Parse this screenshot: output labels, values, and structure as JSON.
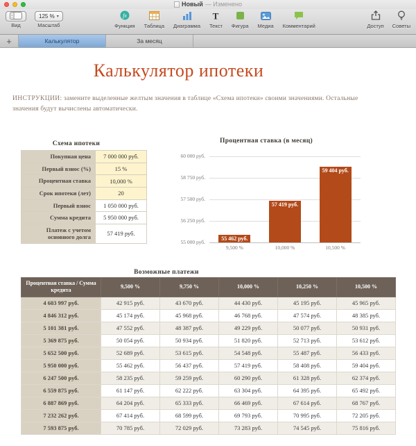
{
  "window": {
    "title": "Новый",
    "status": "— Изменено"
  },
  "toolbar": {
    "view_label": "Вид",
    "zoom_value": "125 %",
    "zoom_label": "Масштаб",
    "items": [
      {
        "label": "Функция",
        "icon": "fx-icon"
      },
      {
        "label": "Таблица",
        "icon": "table-icon"
      },
      {
        "label": "Диаграмма",
        "icon": "chart-icon"
      },
      {
        "label": "Текст",
        "icon": "text-icon"
      },
      {
        "label": "Фигура",
        "icon": "shape-icon"
      },
      {
        "label": "Медиа",
        "icon": "media-icon"
      },
      {
        "label": "Комментарий",
        "icon": "comment-icon"
      }
    ],
    "right": [
      {
        "label": "Доступ",
        "icon": "share-icon"
      },
      {
        "label": "Советы",
        "icon": "tips-icon"
      }
    ]
  },
  "tab_add_label": "+",
  "tabs": [
    {
      "label": "Калькулятор",
      "active": true
    },
    {
      "label": "За месяц",
      "active": false
    }
  ],
  "document": {
    "title": "Калькулятор ипотеки",
    "instructions_prefix": "ИНСТРУКЦИИ:",
    "instructions_body": " замените выделенные желтым значения в таблице «Схема ипотеки» своими значениями. Остальные значения будут вычислены автоматически.",
    "scheme_table": {
      "title": "Схема ипотеки",
      "rows": [
        {
          "label": "Покупная цена",
          "value": "7 000 000 руб.",
          "highlight": true
        },
        {
          "label": "Первый взнос (%)",
          "value": "15 %",
          "highlight": true
        },
        {
          "label": "Процентная ставка",
          "value": "10,000 %",
          "highlight": true
        },
        {
          "label": "Срок ипотеки (лет)",
          "value": "20",
          "highlight": true
        },
        {
          "label": "Первый взнос",
          "value": "1 050 000 руб.",
          "highlight": false
        },
        {
          "label": "Сумма кредита",
          "value": "5 950 000 руб.",
          "highlight": false
        },
        {
          "label": "Платеж с учетом основного долга",
          "value": "57 419 руб.",
          "highlight": false
        }
      ]
    },
    "payments_table": {
      "title": "Возможные платежи",
      "header": [
        "Процентная ставка / Сумма кредита",
        "9,500 %",
        "9,750 %",
        "10,000 %",
        "10,250 %",
        "10,500 %"
      ],
      "rows": [
        {
          "sum": "4 603 997 руб.",
          "cells": [
            "42 915 руб.",
            "43 670 руб.",
            "44 430 руб.",
            "45 195 руб.",
            "45 965 руб."
          ]
        },
        {
          "sum": "4 846 312 руб.",
          "cells": [
            "45 174 руб.",
            "45 968 руб.",
            "46 768 руб.",
            "47 574 руб.",
            "48 385 руб."
          ]
        },
        {
          "sum": "5 101 381 руб.",
          "cells": [
            "47 552 руб.",
            "48 387 руб.",
            "49 229 руб.",
            "50 077 руб.",
            "50 931 руб."
          ]
        },
        {
          "sum": "5 369 875 руб.",
          "cells": [
            "50 054 руб.",
            "50 934 руб.",
            "51 820 руб.",
            "52 713 руб.",
            "53 612 руб."
          ]
        },
        {
          "sum": "5 652 500 руб.",
          "cells": [
            "52 689 руб.",
            "53 615 руб.",
            "54 548 руб.",
            "55 487 руб.",
            "56 433 руб."
          ]
        },
        {
          "sum": "5 950 000 руб.",
          "cells": [
            "55 462 руб.",
            "56 437 руб.",
            "57 419 руб.",
            "58 408 руб.",
            "59 404 руб."
          ]
        },
        {
          "sum": "6 247 500 руб.",
          "cells": [
            "58 235 руб.",
            "59 259 руб.",
            "60 290 руб.",
            "61 328 руб.",
            "62 374 руб."
          ]
        },
        {
          "sum": "6 559 875 руб.",
          "cells": [
            "61 147 руб.",
            "62 222 руб.",
            "63 304 руб.",
            "64 395 руб.",
            "65 492 руб."
          ]
        },
        {
          "sum": "6 887 869 руб.",
          "cells": [
            "64 204 руб.",
            "65 333 руб.",
            "66 469 руб.",
            "67 614 руб.",
            "68 767 руб."
          ]
        },
        {
          "sum": "7 232 262 руб.",
          "cells": [
            "67 414 руб.",
            "68 599 руб.",
            "69 793 руб.",
            "70 995 руб.",
            "72 205 руб."
          ]
        },
        {
          "sum": "7 593 875 руб.",
          "cells": [
            "70 785 руб.",
            "72 029 руб.",
            "73 283 руб.",
            "74 545 руб.",
            "75 816 руб."
          ]
        }
      ]
    }
  },
  "chart_data": {
    "type": "bar",
    "title": "Процентная ставка (в месяц)",
    "categories": [
      "9,500 %",
      "10,000 %",
      "10,500 %"
    ],
    "values": [
      55462,
      57419,
      59404
    ],
    "value_labels": [
      "55 462 руб.",
      "57 419 руб.",
      "59 404 руб."
    ],
    "ylim": [
      55000,
      60000
    ],
    "ytick_labels": [
      "60 000 руб.",
      "58 750 руб.",
      "57 500 руб.",
      "56 250 руб.",
      "55 000 руб."
    ],
    "xlabel": "",
    "ylabel": "",
    "grid": true,
    "legend_position": "none",
    "bar_color": "#b34a1a"
  }
}
